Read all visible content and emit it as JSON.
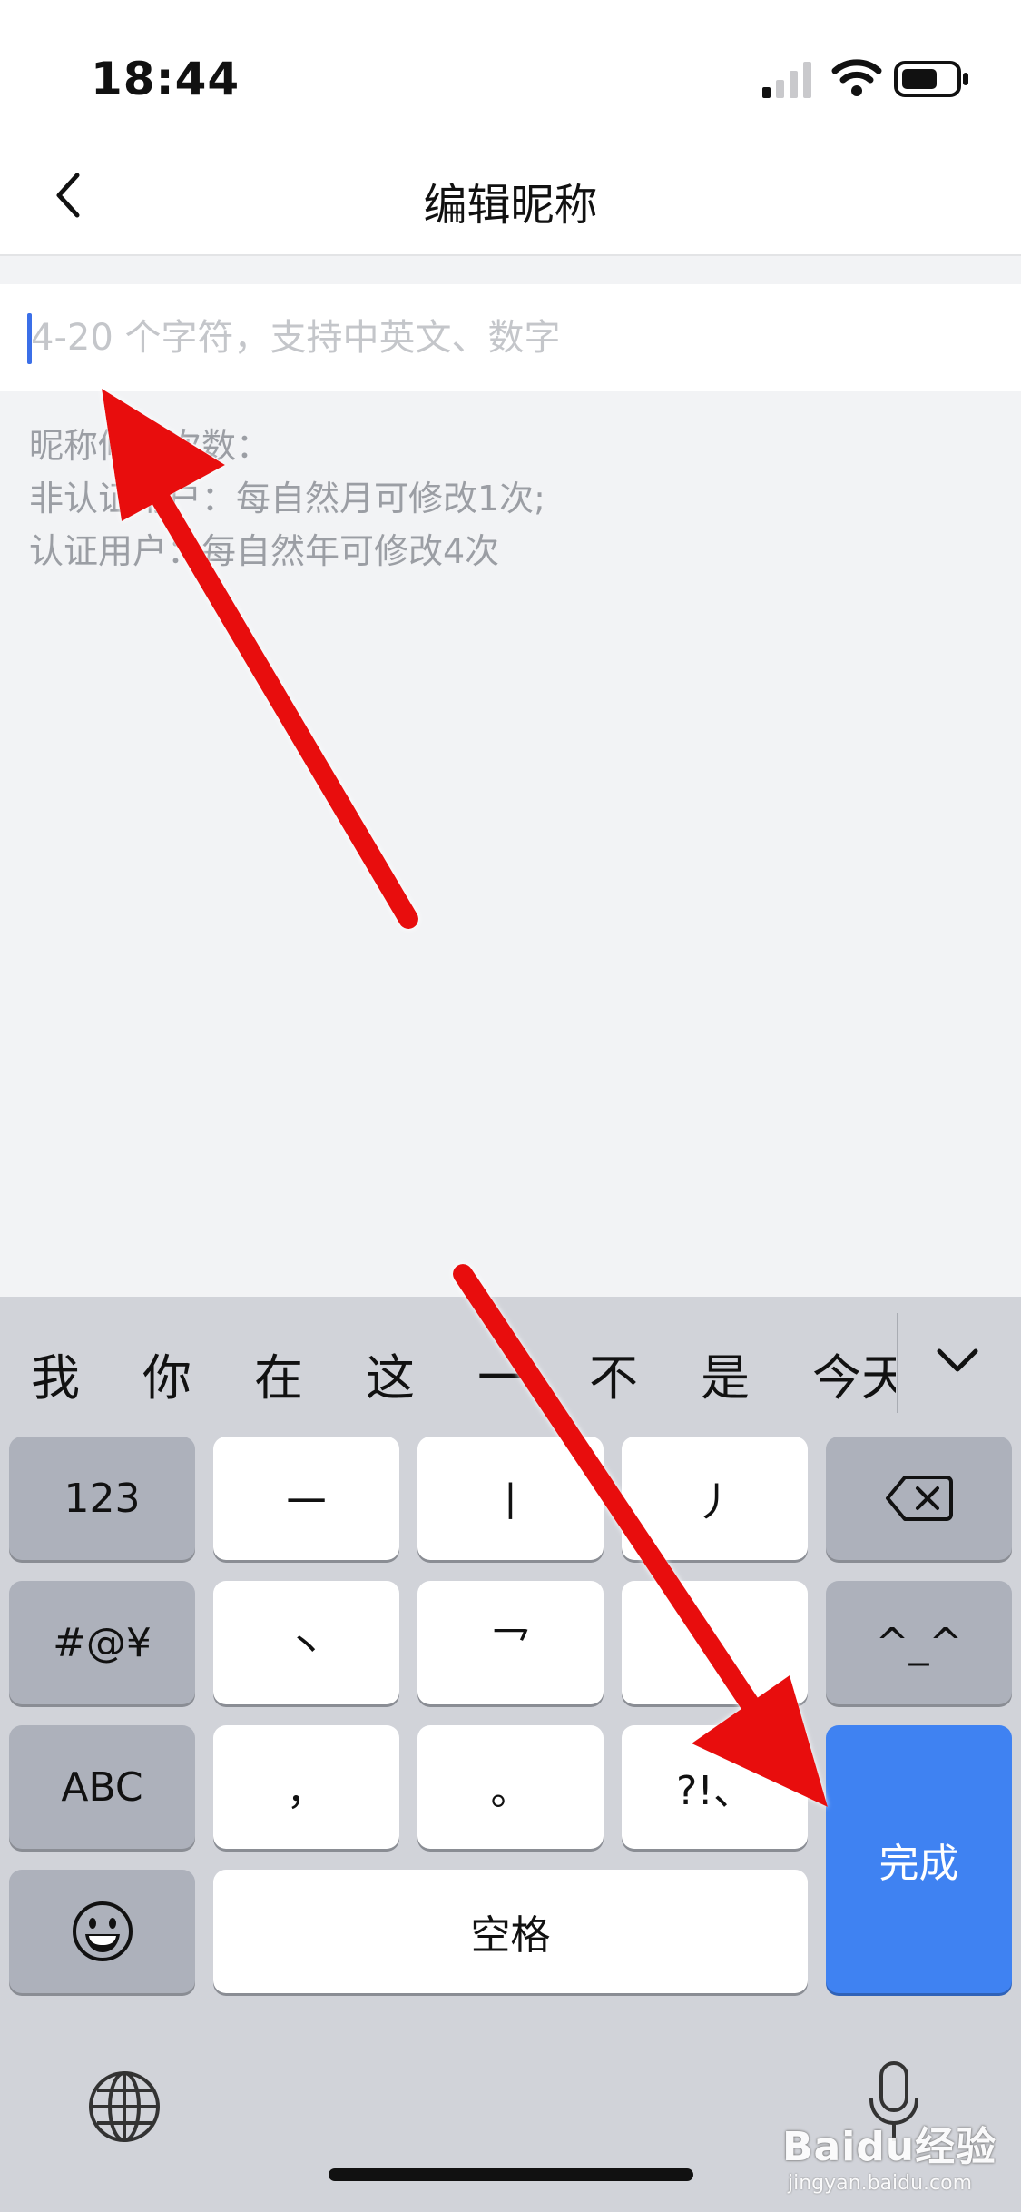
{
  "status_bar": {
    "time": "18:44"
  },
  "nav": {
    "title": "编辑昵称"
  },
  "input": {
    "placeholder": "4-20 个字符，支持中英文、数字",
    "value": ""
  },
  "rules": {
    "lines": [
      "昵称修改次数：",
      "非认证用户：每自然月可修改1次;",
      "认证用户：每自然年可修改4次"
    ]
  },
  "keyboard": {
    "candidates": [
      "我",
      "你",
      "在",
      "这",
      "一",
      "不",
      "是",
      "今天"
    ],
    "keys": {
      "numbers": "123",
      "symbols": "#@¥",
      "abc": "ABC",
      "stroke_heng": "一",
      "stroke_shu": "丨",
      "stroke_pie": "丿",
      "stroke_dian": "丶",
      "stroke_zhe": "乛",
      "comma": "，",
      "period": "。",
      "punct": "?!、",
      "emoticon": "^_^",
      "space": "空格",
      "done": "完成"
    }
  },
  "watermark": {
    "main": "Baidu经验",
    "sub": "jingyan.baidu.com"
  },
  "colors": {
    "accent": "#3f82f2",
    "annotation_arrow": "#e81010",
    "placeholder": "#c4c6ca",
    "hint_text": "#9b9ea4"
  }
}
